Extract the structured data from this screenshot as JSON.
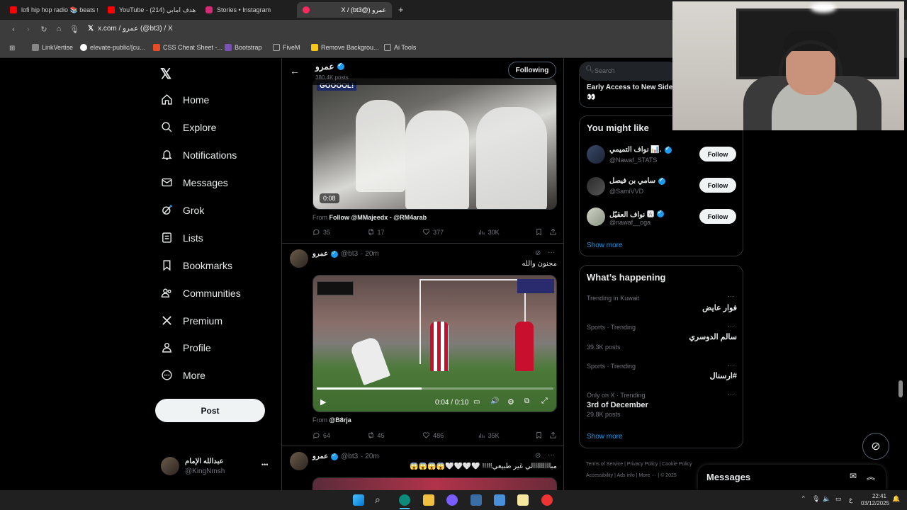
{
  "browser": {
    "tabs": [
      {
        "label": "lofi hip hop radio 📚 beats to",
        "fav_color": "#ff0000"
      },
      {
        "label": "YouTube - هدف امابي (214)",
        "fav_color": "#ff0000"
      },
      {
        "label": "Stories • Instagram",
        "fav_color": "#d62976"
      },
      {
        "label": "X / (bt3@) عمرو",
        "fav_color": "#ff2a60"
      }
    ],
    "new_tab": "+",
    "url": "x.com / عمرو (@bt3) / X",
    "bookmarks": [
      {
        "label": "LinkVertise",
        "color": "#888"
      },
      {
        "label": "elevate-public/[cu...",
        "color": "#fff"
      },
      {
        "label": "CSS Cheat Sheet -...",
        "color": "#e44d26"
      },
      {
        "label": "Bootstrap",
        "color": "#7952b3"
      },
      {
        "label": "FiveM",
        "color": "#aaa"
      },
      {
        "label": "Remove Backgrou...",
        "color": "#f5c518"
      },
      {
        "label": "Ai Tools",
        "color": "#aaa"
      }
    ]
  },
  "sidebar": {
    "items": [
      {
        "label": "Home",
        "icon": "home-icon"
      },
      {
        "label": "Explore",
        "icon": "search-icon"
      },
      {
        "label": "Notifications",
        "icon": "bell-icon"
      },
      {
        "label": "Messages",
        "icon": "mail-icon"
      },
      {
        "label": "Grok",
        "icon": "grok-icon"
      },
      {
        "label": "Lists",
        "icon": "list-icon"
      },
      {
        "label": "Bookmarks",
        "icon": "bookmark-icon"
      },
      {
        "label": "Communities",
        "icon": "people-icon"
      },
      {
        "label": "Premium",
        "icon": "x-icon"
      },
      {
        "label": "Profile",
        "icon": "person-icon"
      },
      {
        "label": "More",
        "icon": "more-icon"
      }
    ],
    "post_label": "Post",
    "account": {
      "name": "عبدالله الإمام",
      "handle": "@KingNmsh",
      "menu": "•••"
    }
  },
  "header": {
    "name": "عمرو",
    "posts_count": "380.4K posts",
    "following_label": "Following"
  },
  "tweets": [
    {
      "video_time": "0:08",
      "overlay_text": "GOOOOL!",
      "from_label": "From",
      "from_text": "Follow @MMajeedx - @RM4arab",
      "replies": "35",
      "retweets": "17",
      "likes": "377",
      "views": "30K"
    },
    {
      "name": "عمرو",
      "handle": "@bt3",
      "time": "· 20m",
      "text": "مجنون والله",
      "player_time": "0:04 / 0:10",
      "from_label": "From",
      "from_text": "@B8rja",
      "replies": "64",
      "retweets": "45",
      "likes": "486",
      "views": "35K"
    },
    {
      "name": "عمرو",
      "handle": "@bt3",
      "time": "· 20m",
      "text": "مبااااااااالي غير طبيعي!!!!! 🤍🤍🤍🤍😱😱😱😱"
    }
  ],
  "search": {
    "placeholder": "Search"
  },
  "early_access": {
    "text": "Early Access to New Sidek",
    "emoji": "👀"
  },
  "you_might_like": {
    "title": "You might like",
    "users": [
      {
        "name": "نواف التميمي 📊.",
        "handle": "@Nawaf_STATS",
        "follow": "Follow"
      },
      {
        "name": "سامي بن فيصل",
        "handle": "@SamiVVD",
        "follow": "Follow"
      },
      {
        "name": "نواف العقيّل 🅰",
        "handle": "@nawaf__oga",
        "follow": "Follow"
      }
    ],
    "show_more": "Show more"
  },
  "whats_happening": {
    "title": "What’s happening",
    "trends": [
      {
        "context": "Trending in Kuwait",
        "name": "فوار عايض",
        "posts": ""
      },
      {
        "context": "Sports · Trending",
        "name": "سالم الدوسري",
        "posts": "39.3K posts"
      },
      {
        "context": "Sports · Trending",
        "name": "#ارسنال",
        "posts": ""
      },
      {
        "context": "Only on X · Trending",
        "name": "3rd of December",
        "posts": "29.8K posts"
      }
    ],
    "show_more": "Show more"
  },
  "footer_links": [
    "Terms of Service",
    "Privacy Policy",
    "Cookie Policy",
    "Accessibility",
    "Ads info",
    "More ···",
    "© 2025"
  ],
  "messages_drawer": {
    "title": "Messages"
  },
  "taskbar": {
    "time": "22:41",
    "date": "03/12/2025",
    "lang": "ع"
  }
}
